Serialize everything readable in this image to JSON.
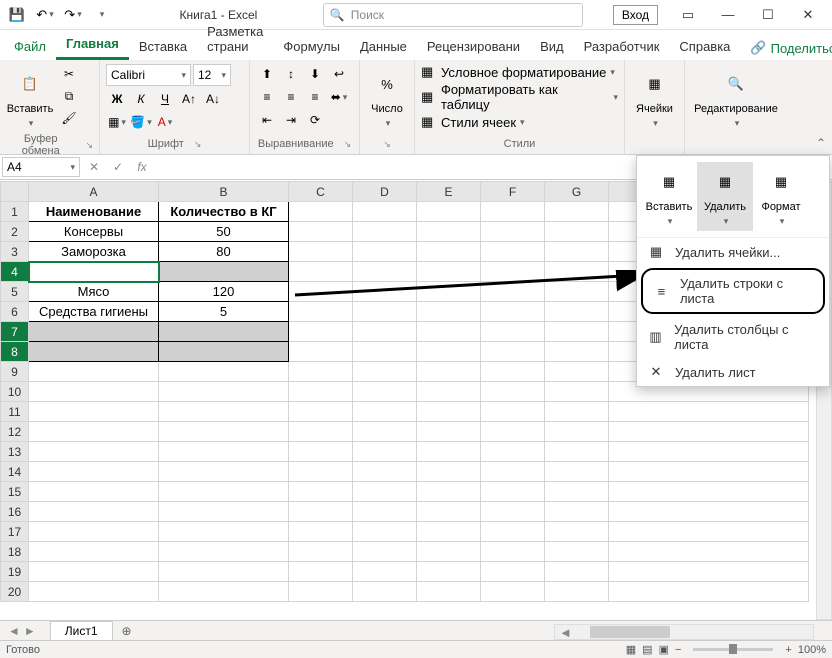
{
  "title": "Книга1 - Excel",
  "search_placeholder": "Поиск",
  "login": "Вход",
  "tabs": {
    "file": "Файл",
    "home": "Главная",
    "insert": "Вставка",
    "layout": "Разметка страни",
    "formulas": "Формулы",
    "data": "Данные",
    "review": "Рецензировани",
    "view": "Вид",
    "developer": "Разработчик",
    "help": "Справка"
  },
  "share": "Поделиться",
  "ribbon": {
    "clipboard": {
      "paste": "Вставить",
      "label": "Буфер обмена"
    },
    "font": {
      "name": "Calibri",
      "size": "12",
      "label": "Шрифт",
      "bold": "Ж",
      "italic": "К",
      "underline": "Ч"
    },
    "alignment": {
      "label": "Выравнивание"
    },
    "number": {
      "label": "Число"
    },
    "styles": {
      "cond": "Условное форматирование",
      "table": "Форматировать как таблицу",
      "cells": "Стили ячеек",
      "label": "Стили"
    },
    "cells_group": {
      "label": "Ячейки"
    },
    "editing": {
      "label": "Редактирование"
    }
  },
  "namebox": "A4",
  "columns": [
    "A",
    "B",
    "C",
    "D",
    "E",
    "F",
    "G"
  ],
  "rows": [
    1,
    2,
    3,
    4,
    5,
    6,
    7,
    8,
    9,
    10,
    11,
    12,
    13,
    14,
    15,
    16,
    17,
    18,
    19,
    20
  ],
  "table": {
    "header": {
      "a": "Наименование",
      "b": "Количество в КГ"
    },
    "r2": {
      "a": "Консервы",
      "b": "50"
    },
    "r3": {
      "a": "Заморозка",
      "b": "80"
    },
    "r4": {
      "a": "",
      "b": ""
    },
    "r5": {
      "a": "Мясо",
      "b": "120"
    },
    "r6": {
      "a": "Средства гигиены",
      "b": "5"
    }
  },
  "cells_panel": {
    "insert": "Вставить",
    "delete": "Удалить",
    "format": "Формат",
    "m1": "Удалить ячейки...",
    "m2": "Удалить строки с листа",
    "m3": "Удалить столбцы с листа",
    "m4": "Удалить лист"
  },
  "sheet": "Лист1",
  "status": "Готово",
  "zoom": "100%"
}
